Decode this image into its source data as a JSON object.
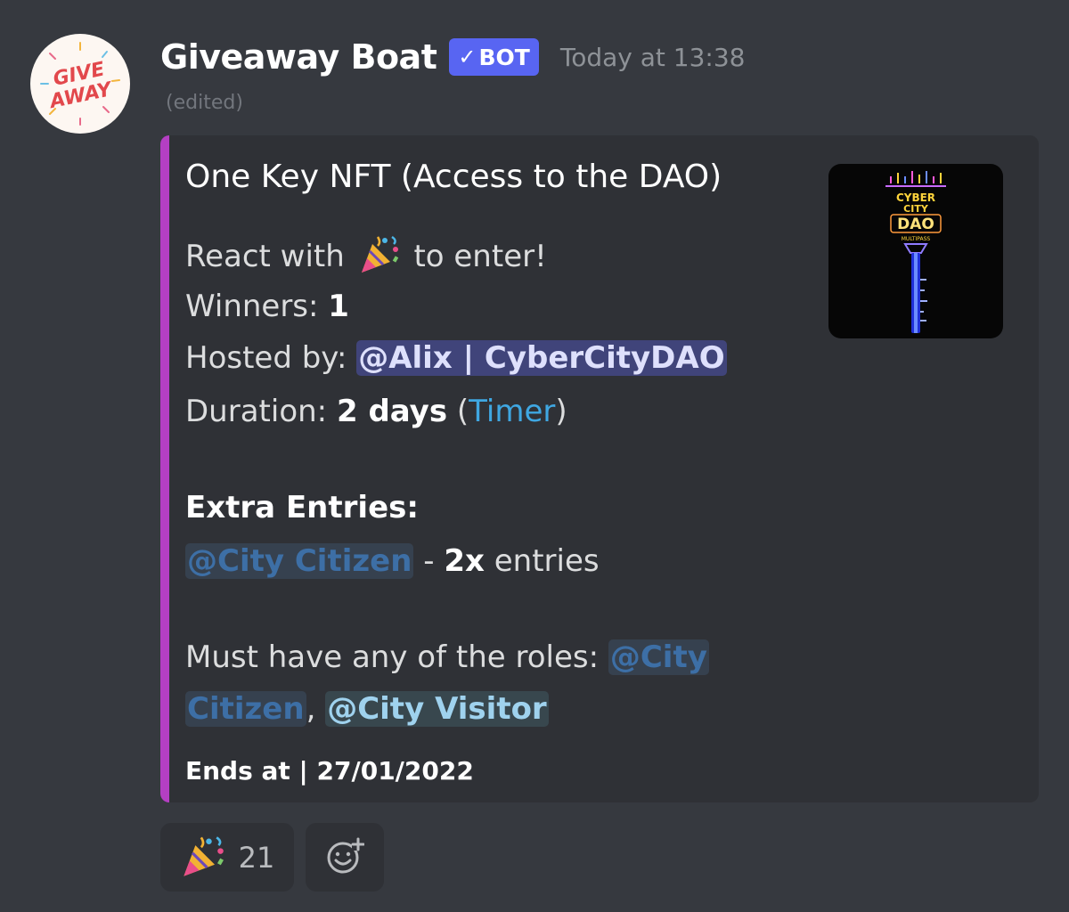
{
  "author": {
    "name": "Giveaway Boat",
    "badge": "BOT",
    "timestamp": "Today at 13:38",
    "edited": "(edited)",
    "avatar_text": [
      "GIVE",
      "AWAY"
    ]
  },
  "embed": {
    "title": "One Key NFT (Access to the DAO)",
    "react_prefix": "React with",
    "react_suffix": "to enter!",
    "winners_label": "Winners:",
    "winners_value": "1",
    "hosted_label": "Hosted by:",
    "host_mention": "@Alix | CyberCityDAO",
    "duration_label": "Duration:",
    "duration_value": "2 days",
    "paren_open": "(",
    "timer_link": "Timer",
    "paren_close": ")",
    "extra_heading": "Extra Entries:",
    "extra_role": "@City Citizen",
    "extra_sep": "-",
    "extra_mult": "2x",
    "extra_suffix": "entries",
    "roles_prefix": "Must have any of the roles:",
    "role1_part1": "@City",
    "role1_part2": "Citizen",
    "roles_comma": ",",
    "role2": "@City Visitor",
    "footer": "Ends at | 27/01/2022",
    "thumbnail": {
      "line1": "CYBER",
      "line2": "CITY",
      "line3": "DAO",
      "line4": "MULTIPASS"
    },
    "accent_color": "#b43fc3"
  },
  "reactions": [
    {
      "emoji": "party-popper-icon",
      "count": "21"
    }
  ],
  "colors": {
    "background": "#36393f",
    "embed": "#2f3136",
    "user_mention": "#40447a",
    "role_mention_text": "#3d6fa6",
    "link": "#3fa7e2",
    "bot_badge": "#5865f2"
  }
}
